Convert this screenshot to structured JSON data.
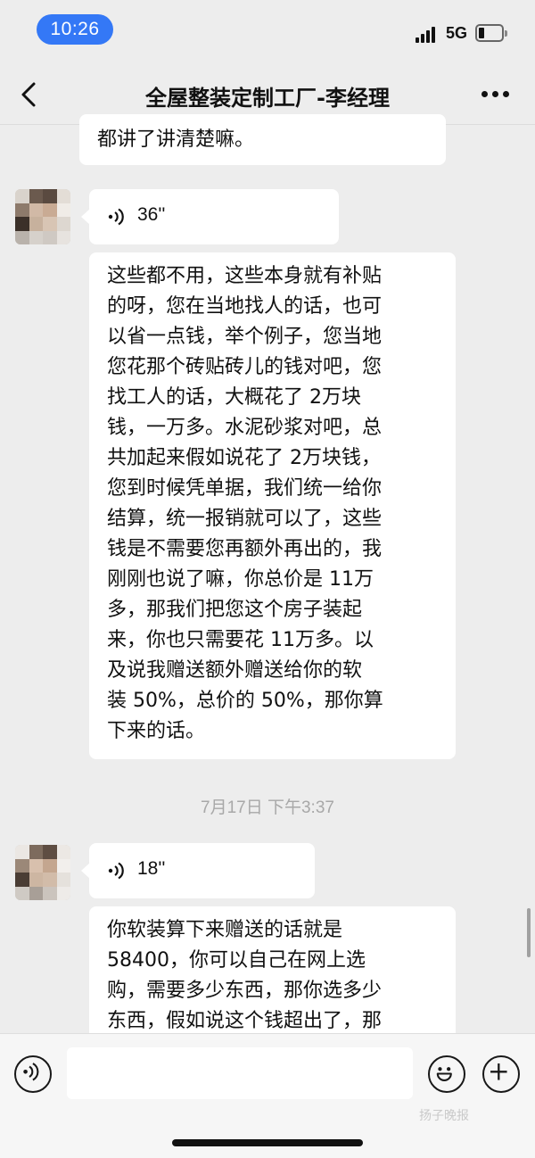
{
  "status_bar": {
    "time": "10:26",
    "network": "5G"
  },
  "nav": {
    "title": "全屋整装定制工厂-李经理"
  },
  "messages": [
    {
      "type": "text",
      "lines": [
        "都讲了讲清楚嘛。"
      ]
    },
    {
      "type": "voice",
      "duration": "36''"
    },
    {
      "type": "text",
      "lines": [
        "这些都不用，这些本身就有补贴",
        "的呀，您在当地找人的话，也可",
        "以省一点钱，举个例子，您当地",
        "您花那个砖贴砖儿的钱对吧，您",
        "找工人的话，大概花了 2万块",
        "钱，一万多。水泥砂浆对吧，总",
        "共加起来假如说花了 2万块钱，",
        "您到时候凭单据，我们统一给你",
        "结算，统一报销就可以了，这些",
        "钱是不需要您再额外再出的，我",
        "刚刚也说了嘛，你总价是 11万",
        "多，那我们把您这个房子装起",
        "来，你也只需要花 11万多。以",
        "及说我赠送额外赠送给你的软",
        "装 50%，总价的 50%，那你算",
        "下来的话。"
      ]
    },
    {
      "type": "timestamp",
      "text": "7月17日 下午3:37"
    },
    {
      "type": "voice",
      "duration": "18''"
    },
    {
      "type": "text",
      "lines": [
        "你软装算下来赠送的话就是",
        "58400，你可以自己在网上选",
        "购，需要多少东西，那你选多少",
        "东西，假如说这个钱超出了，那"
      ]
    }
  ],
  "input_bar": {
    "voice_button": "voice-icon",
    "emoji_button": "emoji-icon",
    "plus_button": "plus-icon",
    "text_value": ""
  },
  "watermark": "扬子晚报",
  "colors": {
    "time_pill": "#3478f6",
    "chat_background": "#ededed",
    "bubble": "#ffffff"
  }
}
